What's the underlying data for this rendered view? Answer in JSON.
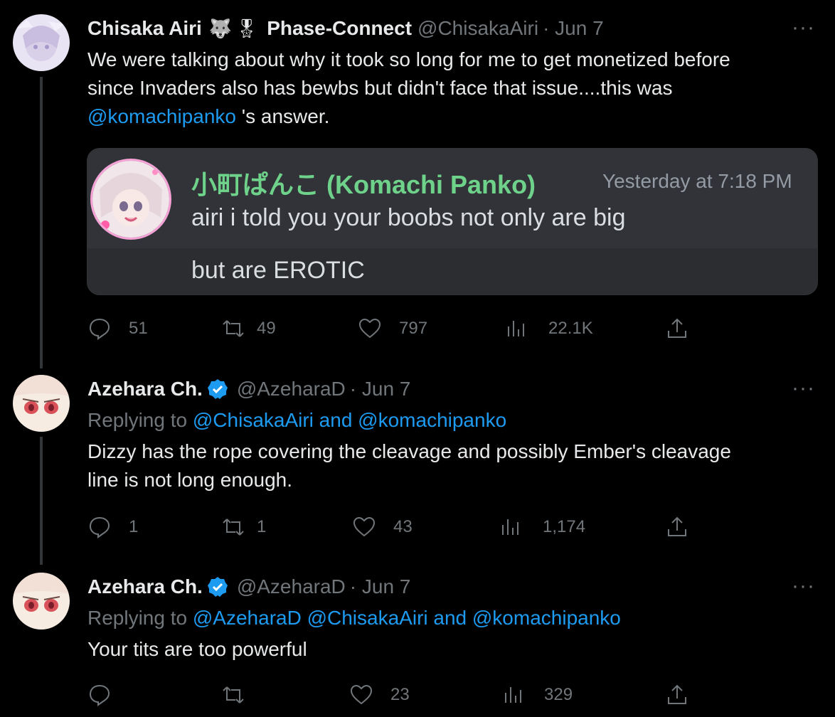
{
  "tweets": [
    {
      "name": "Chisaka Airi",
      "emoji1": "🐺",
      "emoji2": "🎖",
      "affiliation": "Phase-Connect",
      "handle": "@ChisakaAiri",
      "date": "· Jun 7",
      "more": "···",
      "text1": "We were talking about why it took so long for me to get monetized before",
      "text2": "since Invaders also has bewbs but didn't face that issue....this was",
      "mention": "@komachipanko",
      "text3": " 's answer.",
      "embed": {
        "author": "小町ぱんこ (Komachi Panko)",
        "time": "Yesterday at 7:18 PM",
        "line1": "airi i told you your boobs not only are big",
        "line2": "but are EROTIC"
      },
      "replies": "51",
      "retweets": "49",
      "likes": "797",
      "views": "22.1K"
    },
    {
      "name": "Azehara Ch.",
      "handle": "@AzeharaD",
      "date": "· Jun 7",
      "more": "···",
      "replying_prefix": "Replying to ",
      "replying_targets": "@ChisakaAiri and @komachipanko",
      "text1": "Dizzy has the rope covering the cleavage and possibly Ember's cleavage",
      "text2": "line is not long enough.",
      "replies": "1",
      "retweets": "1",
      "likes": "43",
      "views": "1,174"
    },
    {
      "name": "Azehara Ch.",
      "handle": "@AzeharaD",
      "date": "· Jun 7",
      "more": "···",
      "replying_prefix": "Replying to ",
      "replying_targets": "@AzeharaD @ChisakaAiri and @komachipanko",
      "text1": "Your tits are too powerful",
      "replies": "",
      "retweets": "",
      "likes": "23",
      "views": "329"
    }
  ],
  "colors": {
    "background": "#000000",
    "text": "#e7e9ea",
    "secondary": "#71767b",
    "link": "#1d9bf0",
    "verified": "#1d9bf0",
    "discord_name": "#6fd28a"
  },
  "icons": [
    "reply-icon",
    "retweet-icon",
    "like-icon",
    "views-icon",
    "share-icon",
    "more-icon",
    "verified-badge-icon"
  ]
}
